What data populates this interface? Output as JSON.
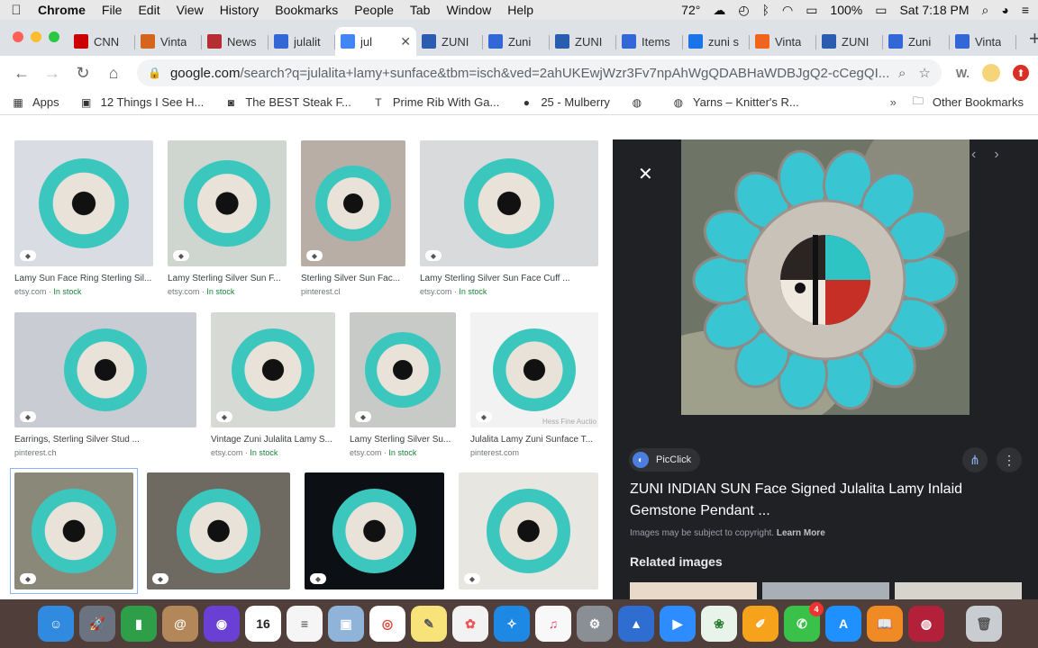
{
  "menubar": {
    "app": "Chrome",
    "items": [
      "File",
      "Edit",
      "View",
      "History",
      "Bookmarks",
      "People",
      "Tab",
      "Window",
      "Help"
    ],
    "temperature": "72°",
    "battery": "100%",
    "clock": "Sat 7:18 PM"
  },
  "tabs": [
    {
      "label": "CNN",
      "icon": "cnn-icon",
      "color": "#cc0000"
    },
    {
      "label": "Vinta",
      "icon": "etsy-icon",
      "color": "#d5641c"
    },
    {
      "label": "News",
      "icon": "news-icon",
      "color": "#b52e31"
    },
    {
      "label": "julalit",
      "icon": "shopping-icon",
      "color": "#3367d6"
    },
    {
      "label": "jul",
      "icon": "google-icon",
      "color": "#4285f4",
      "active": true
    },
    {
      "label": "ZUNI",
      "icon": "picclick-icon",
      "color": "#2a5db0"
    },
    {
      "label": "Zuni",
      "icon": "shopping-icon",
      "color": "#3367d6"
    },
    {
      "label": "ZUNI",
      "icon": "picclick-icon",
      "color": "#2a5db0"
    },
    {
      "label": "Items",
      "icon": "shopping-icon",
      "color": "#3367d6"
    },
    {
      "label": "zuni s",
      "icon": "spiral-icon",
      "color": "#1a73e8"
    },
    {
      "label": "Vinta",
      "icon": "etsy-icon",
      "color": "#f1641e"
    },
    {
      "label": "ZUNI",
      "icon": "picclick-icon",
      "color": "#2a5db0"
    },
    {
      "label": "Zuni",
      "icon": "shopping-icon",
      "color": "#3367d6"
    },
    {
      "label": "Vinta",
      "icon": "shopping-icon",
      "color": "#3367d6"
    }
  ],
  "toolbar": {
    "url_host": "google.com",
    "url_path": "/search?q=julalita+lamy+sunface&tbm=isch&ved=2ahUKEwjWzr3Fv7npAhWgQDABHaWDBJgQ2-cCegQI...",
    "ext_label": "W."
  },
  "bookmarks": [
    {
      "label": "Apps",
      "icon": "apps-grid-icon"
    },
    {
      "label": "12 Things I See H...",
      "icon": "bookmark-thumb-icon"
    },
    {
      "label": "The BEST Steak F...",
      "icon": "recipe-icon"
    },
    {
      "label": "Prime Rib With Ga...",
      "icon": "t-icon"
    },
    {
      "label": "25 - Mulberry",
      "icon": "mulberry-icon"
    },
    {
      "label": "",
      "icon": "globe-icon"
    },
    {
      "label": "Yarns – Knitter's R...",
      "icon": "globe-icon"
    },
    {
      "label": "Other Bookmarks",
      "icon": "folder-icon"
    }
  ],
  "results": [
    {
      "caption": "Lamy Sun Face Ring Sterling Sil...",
      "source": "etsy.com",
      "stock": "In stock",
      "bg": "#d9dde3"
    },
    {
      "caption": "Lamy Sterling Silver Sun F...",
      "source": "etsy.com",
      "stock": "In stock",
      "bg": "#cfd5cf"
    },
    {
      "caption": "Sterling Silver Sun Fac...",
      "source": "pinterest.cl",
      "stock": "",
      "bg": "#b8aea6"
    },
    {
      "caption": "Lamy Sterling Silver Sun Face Cuff ...",
      "source": "etsy.com",
      "stock": "In stock",
      "bg": "#d8dadc"
    },
    {
      "caption": "Earrings, Sterling Silver Stud ...",
      "source": "pinterest.ch",
      "stock": "",
      "bg": "#c9ccd2"
    },
    {
      "caption": "Vintage Zuni Julalita Lamy S...",
      "source": "etsy.com",
      "stock": "In stock",
      "bg": "#d6d9d4"
    },
    {
      "caption": "Lamy Sterling Silver Su...",
      "source": "etsy.com",
      "stock": "In stock",
      "bg": "#c7cac7"
    },
    {
      "caption": "Julalita Lamy Zuni Sunface T...",
      "source": "pinterest.com",
      "stock": "",
      "bg": "#f2f2f2",
      "watermark": "Hess Fine Auctio"
    },
    {
      "caption": "",
      "source": "",
      "stock": "",
      "bg": "#8a8878"
    },
    {
      "caption": "",
      "source": "",
      "stock": "",
      "bg": "#6e6a62"
    },
    {
      "caption": "",
      "source": "",
      "stock": "",
      "bg": "#0c0f14"
    },
    {
      "caption": "",
      "source": "",
      "stock": "",
      "bg": "#e8e6e1"
    }
  ],
  "panel": {
    "source": "PicClick",
    "title": "ZUNI INDIAN SUN Face Signed Julalita Lamy Inlaid Gemstone Pendant ...",
    "copyright": "Images may be subject to copyright.",
    "learn_more": "Learn More",
    "related": "Related images"
  },
  "dock": [
    {
      "name": "finder-icon",
      "color": "#2f8ae0",
      "glyph": "☺"
    },
    {
      "name": "launchpad-icon",
      "color": "#6b7280",
      "glyph": "🚀"
    },
    {
      "name": "numbers-icon",
      "color": "#2e9e48",
      "glyph": "▮"
    },
    {
      "name": "contacts-icon",
      "color": "#b3875a",
      "glyph": "@"
    },
    {
      "name": "siri-icon",
      "color": "#6a3fd4",
      "glyph": "◉"
    },
    {
      "name": "calendar-icon",
      "color": "#ffffff",
      "glyph": "16",
      "textcolor": "#222"
    },
    {
      "name": "reminders-icon",
      "color": "#f5f5f5",
      "glyph": "≡",
      "textcolor": "#444"
    },
    {
      "name": "preview-icon",
      "color": "#8fb3d9",
      "glyph": "▣"
    },
    {
      "name": "chrome-icon",
      "color": "#ffffff",
      "glyph": "◎",
      "textcolor": "#db4437"
    },
    {
      "name": "notes-icon",
      "color": "#f8e27a",
      "glyph": "✎",
      "textcolor": "#555"
    },
    {
      "name": "photos-icon",
      "color": "#f2f2f2",
      "glyph": "✿",
      "textcolor": "#e55"
    },
    {
      "name": "safari-icon",
      "color": "#1e88e5",
      "glyph": "✧"
    },
    {
      "name": "itunes-icon",
      "color": "#f8f8f8",
      "glyph": "♫",
      "textcolor": "#e0407a"
    },
    {
      "name": "system-preferences-icon",
      "color": "#8a8f96",
      "glyph": "⚙"
    },
    {
      "name": "keynote-icon",
      "color": "#2f6dd0",
      "glyph": "▲"
    },
    {
      "name": "zoom-icon",
      "color": "#2d8cff",
      "glyph": "▶"
    },
    {
      "name": "gardening-app-icon",
      "color": "#e8f4ea",
      "glyph": "❀",
      "textcolor": "#2e7d32"
    },
    {
      "name": "pages-icon",
      "color": "#f6a21a",
      "glyph": "✐"
    },
    {
      "name": "facetime-icon",
      "color": "#3ac14a",
      "glyph": "✆",
      "badge": "4"
    },
    {
      "name": "app-store-icon",
      "color": "#1e90ff",
      "glyph": "A"
    },
    {
      "name": "books-icon",
      "color": "#f08a24",
      "glyph": "📖"
    },
    {
      "name": "photo-booth-icon",
      "color": "#b3203a",
      "glyph": "◍"
    },
    {
      "name": "trash-icon",
      "color": "#c9ccd0",
      "glyph": "🗑",
      "textcolor": "#555"
    }
  ]
}
